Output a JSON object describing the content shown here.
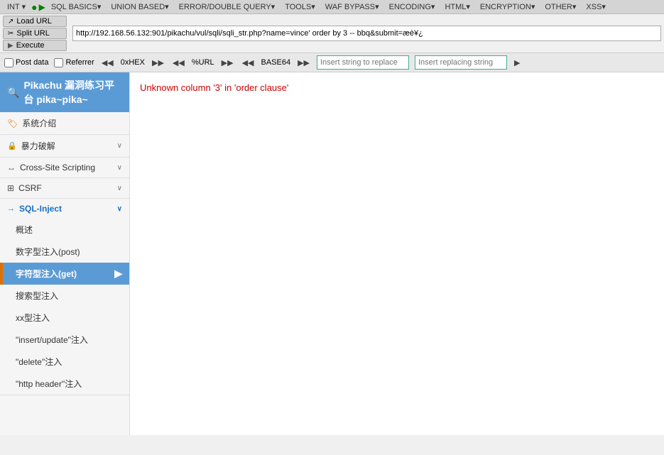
{
  "toolbar": {
    "load_url_label": "Load URL",
    "split_url_label": "Split URL",
    "execute_label": "Execute",
    "url_value": "http://192.168.56.132:901/pikachu/vul/sqli/sqli_str.php?name=vince' order by 3 -- bbq&submit=æè¥¿"
  },
  "menubar": {
    "items": [
      {
        "label": "INT",
        "type": "dropdown"
      },
      {
        "label": "●",
        "type": "icon-green"
      },
      {
        "label": "▶",
        "type": "icon-green"
      },
      {
        "label": "SQL BASICS▼",
        "type": "dropdown"
      },
      {
        "label": "UNION BASED▼",
        "type": "dropdown"
      },
      {
        "label": "ERROR/DOUBLE QUERY▼",
        "type": "dropdown"
      },
      {
        "label": "TOOLS▼",
        "type": "dropdown"
      },
      {
        "label": "WAF BYPASS▼",
        "type": "dropdown"
      },
      {
        "label": "ENCODING▼",
        "type": "dropdown"
      },
      {
        "label": "HTML▼",
        "type": "dropdown"
      },
      {
        "label": "ENCRYPTION▼",
        "type": "dropdown"
      },
      {
        "label": "OTHER▼",
        "type": "dropdown"
      },
      {
        "label": "XSS▼",
        "type": "dropdown"
      }
    ]
  },
  "checkboxbar": {
    "post_data": "Post data",
    "referrer": "Referrer",
    "hex_label": "0xHEX",
    "url_label": "%URL",
    "base64_label": "BASE64",
    "insert_string_replace": "Insert string to replace",
    "insert_replacing_string": "Insert replacing string"
  },
  "sidebar": {
    "header": "Pikachu 漏洞练习平台 pika~pika~",
    "items": [
      {
        "id": "intro",
        "label": "系统介绍",
        "icon": "tag",
        "sub": false,
        "active": false
      },
      {
        "id": "bruteforce",
        "label": "暴力破解",
        "icon": "lock",
        "sub": false,
        "active": false,
        "expanded": true
      },
      {
        "id": "xss",
        "label": "Cross-Site Scripting",
        "icon": "xsite",
        "sub": false,
        "active": false,
        "expanded": true
      },
      {
        "id": "csrf",
        "label": "CSRF",
        "icon": "csrf",
        "sub": false,
        "active": false,
        "expanded": true
      },
      {
        "id": "sqlinject",
        "label": "SQL-Inject",
        "icon": "sql",
        "sub": false,
        "active": true,
        "expanded": true
      }
    ],
    "sql_subitems": [
      {
        "id": "overview",
        "label": "概述",
        "active": false
      },
      {
        "id": "numericpost",
        "label": "数字型注入(post)",
        "active": false
      },
      {
        "id": "stringget",
        "label": "字符型注入(get)",
        "active": true
      },
      {
        "id": "searchtype",
        "label": "搜索型注入",
        "active": false
      },
      {
        "id": "xxtype",
        "label": "xx型注入",
        "active": false
      },
      {
        "id": "insertupdate",
        "label": "\"insert/update\"注入",
        "active": false
      },
      {
        "id": "delete",
        "label": "\"delete\"注入",
        "active": false
      },
      {
        "id": "httpheader",
        "label": "\"http header\"注入",
        "active": false
      }
    ]
  },
  "content": {
    "error_text": "Unknown column '3' in 'order clause'"
  }
}
